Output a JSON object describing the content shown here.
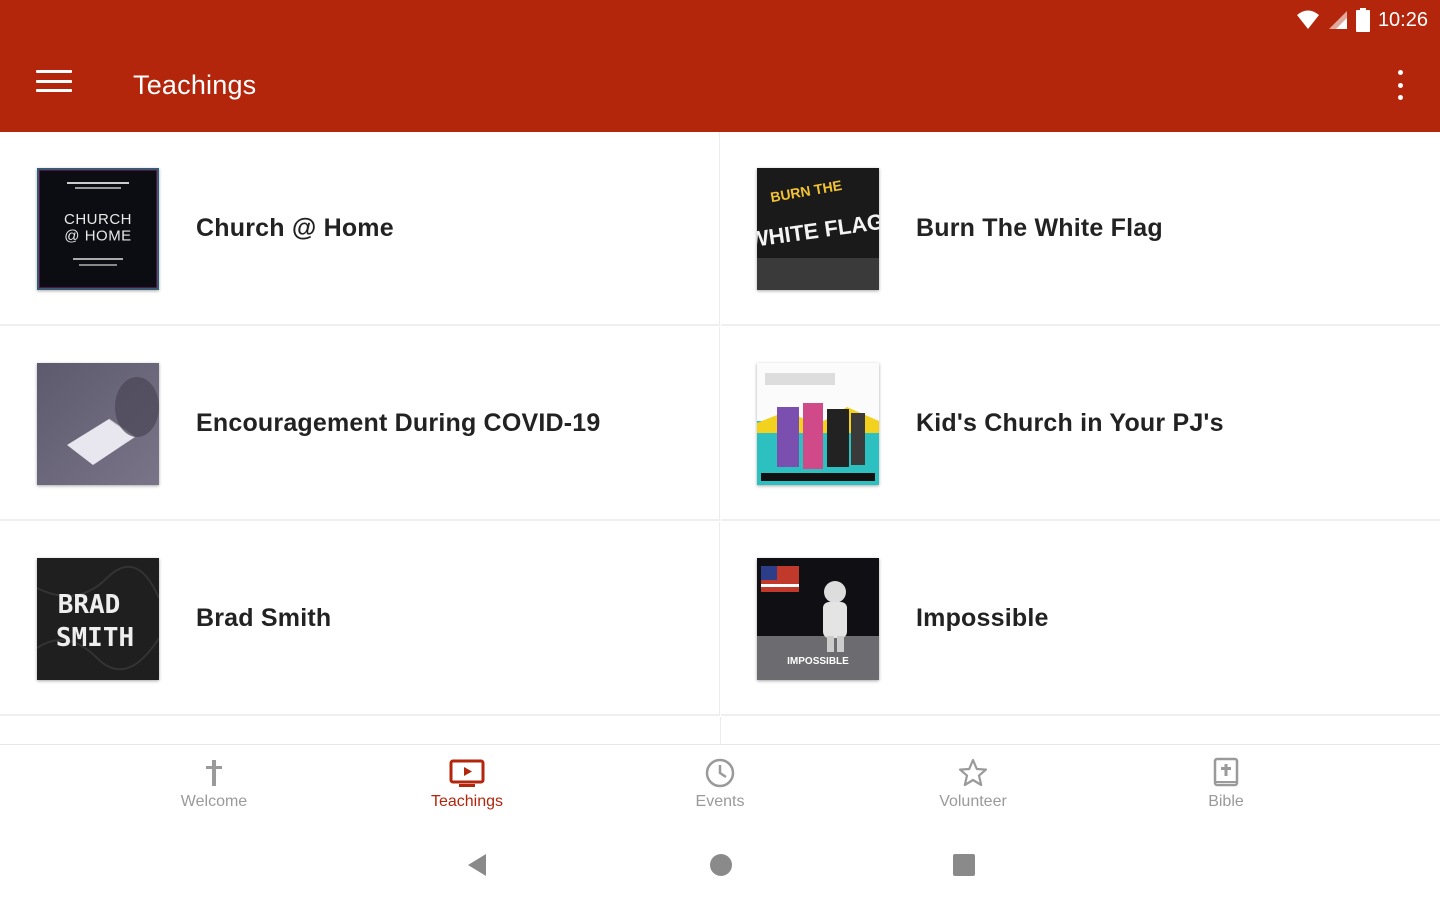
{
  "status_bar": {
    "time": "10:26"
  },
  "app_bar": {
    "title": "Teachings"
  },
  "teachings": [
    {
      "label": "Church @ Home"
    },
    {
      "label": "Burn The White Flag"
    },
    {
      "label": "Encouragement During COVID-19"
    },
    {
      "label": "Kid's Church in Your PJ's"
    },
    {
      "label": "Brad Smith"
    },
    {
      "label": "Impossible"
    }
  ],
  "thumb_text": {
    "church_home": "CHURCH\n@ HOME",
    "burn_top": "BURN THE",
    "burn_main": "WHITE FLAG",
    "brad_smith_1": "BRAD",
    "brad_smith_2": "SMITH",
    "impossible": "IMPOSSIBLE"
  },
  "bottom_nav": [
    {
      "label": "Welcome",
      "icon": "cross-icon",
      "active": false
    },
    {
      "label": "Teachings",
      "icon": "tv-play-icon",
      "active": true
    },
    {
      "label": "Events",
      "icon": "clock-icon",
      "active": false
    },
    {
      "label": "Volunteer",
      "icon": "star-icon",
      "active": false
    },
    {
      "label": "Bible",
      "icon": "bible-icon",
      "active": false
    }
  ],
  "colors": {
    "accent": "#b3260b",
    "inactive": "#9a9a9a"
  }
}
